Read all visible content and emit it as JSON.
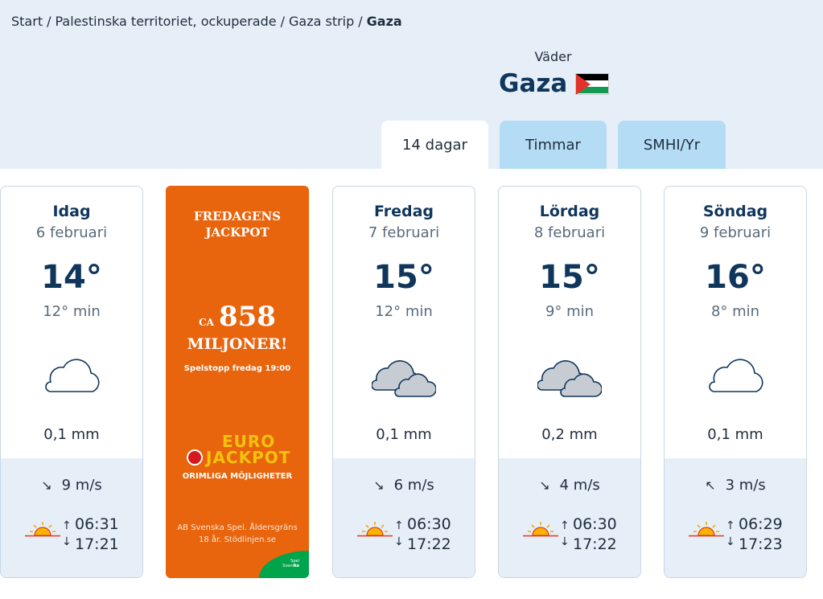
{
  "breadcrumb": {
    "items": [
      "Start",
      "Palestinska territoriet, ockuperade",
      "Gaza strip"
    ],
    "current": "Gaza",
    "separator": "/"
  },
  "header": {
    "subtitle": "Väder",
    "city": "Gaza",
    "flag_icon": "palestine-flag-icon"
  },
  "tabs": [
    {
      "label": "14 dagar",
      "active": true
    },
    {
      "label": "Timmar",
      "active": false
    },
    {
      "label": "SMHI/Yr",
      "active": false
    }
  ],
  "days": [
    {
      "day": "Idag",
      "date": "6 februari",
      "temp": "14°",
      "min": "12° min",
      "icon": "cloud-icon",
      "precip": "0,1 mm",
      "wind_arrow": "↘",
      "wind": "9 m/s",
      "sunrise": "06:31",
      "sunset": "17:21"
    },
    {
      "day": "Fredag",
      "date": "7 februari",
      "temp": "15°",
      "min": "12° min",
      "icon": "clouds-icon",
      "precip": "0,1 mm",
      "wind_arrow": "↘",
      "wind": "6 m/s",
      "sunrise": "06:30",
      "sunset": "17:22"
    },
    {
      "day": "Lördag",
      "date": "8 februari",
      "temp": "15°",
      "min": "9° min",
      "icon": "clouds-icon",
      "precip": "0,2 mm",
      "wind_arrow": "↘",
      "wind": "4 m/s",
      "sunrise": "06:30",
      "sunset": "17:22"
    },
    {
      "day": "Söndag",
      "date": "9 februari",
      "temp": "16°",
      "min": "8° min",
      "icon": "cloud-icon",
      "precip": "0,1 mm",
      "wind_arrow": "↖",
      "wind": "3 m/s",
      "sunrise": "06:29",
      "sunset": "17:23"
    }
  ],
  "ad": {
    "headline_1": "FREDAGENS",
    "headline_2": "JACKPOT",
    "ca": "CA",
    "amount": "858",
    "miljoner": "MILJONER!",
    "stop": "Spelstopp fredag 19:00",
    "logo_euro": "EURO",
    "logo_jackpot": "JACKPOT",
    "orimliga": "ORIMLIGA MÖJLIGHETER",
    "footer_1": "AB Svenska Spel. Åldersgräns",
    "footer_2": "18 år. Stödlinjen.se",
    "corner_1": "Svenska",
    "corner_2": "Spel Tur"
  },
  "colors": {
    "band": "#e6eff8",
    "title": "#10365c",
    "tab_inactive": "#b5dcf5",
    "ad_orange": "#e8650e",
    "ad_gold": "#f4c20d"
  }
}
